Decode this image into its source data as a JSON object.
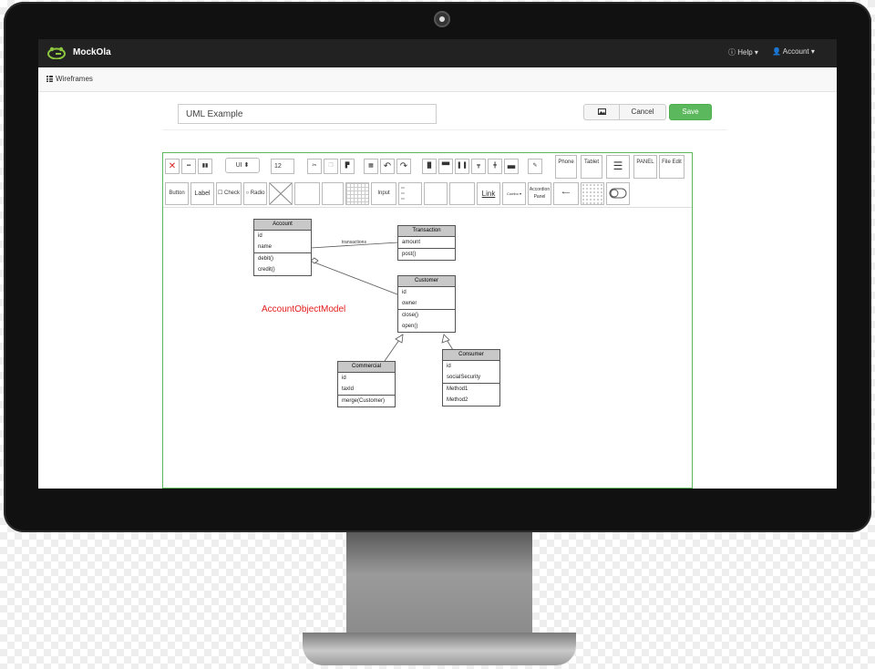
{
  "app": {
    "brand": "MockOla",
    "accent": "#5cb85c"
  },
  "nav": {
    "help": "Help ▾",
    "account": "Account ▾"
  },
  "breadcrumb": {
    "label": "Wireframes"
  },
  "editor": {
    "title_value": "UML Example",
    "buttons": {
      "cancel": "Cancel",
      "save": "Save"
    },
    "toolbar": {
      "font_select": "UI",
      "font_size": "12",
      "widgets": {
        "phone": "Phone",
        "tablet": "Tablet",
        "panel": "PANEL",
        "menu_file": "File",
        "menu_edit": "Edit",
        "button": "Button",
        "label": "Label",
        "check": "Check",
        "radio": "Radio",
        "input": "Input",
        "link": "Link",
        "combo": "Combo",
        "accordion": "Accordion Panel"
      }
    },
    "diagram": {
      "model_label": "AccountObjectModel",
      "association_label": "transactions",
      "classes": {
        "account": {
          "name": "Account",
          "attrs": [
            "id",
            "name"
          ],
          "methods": [
            "debit()",
            "credit()"
          ]
        },
        "transaction": {
          "name": "Transaction",
          "attrs": [
            "amount"
          ],
          "methods": [
            "post()"
          ]
        },
        "customer": {
          "name": "Customer",
          "attrs": [
            "id",
            "owner"
          ],
          "methods": [
            "close()",
            "open()"
          ]
        },
        "commercial": {
          "name": "Commercial",
          "attrs": [
            "id",
            "taxId"
          ],
          "methods": [
            "merge(Customer)"
          ]
        },
        "consumer": {
          "name": "Consumer",
          "attrs": [
            "id",
            "socialSecurity"
          ],
          "methods": [
            "Method1",
            "Method2"
          ]
        }
      }
    }
  }
}
